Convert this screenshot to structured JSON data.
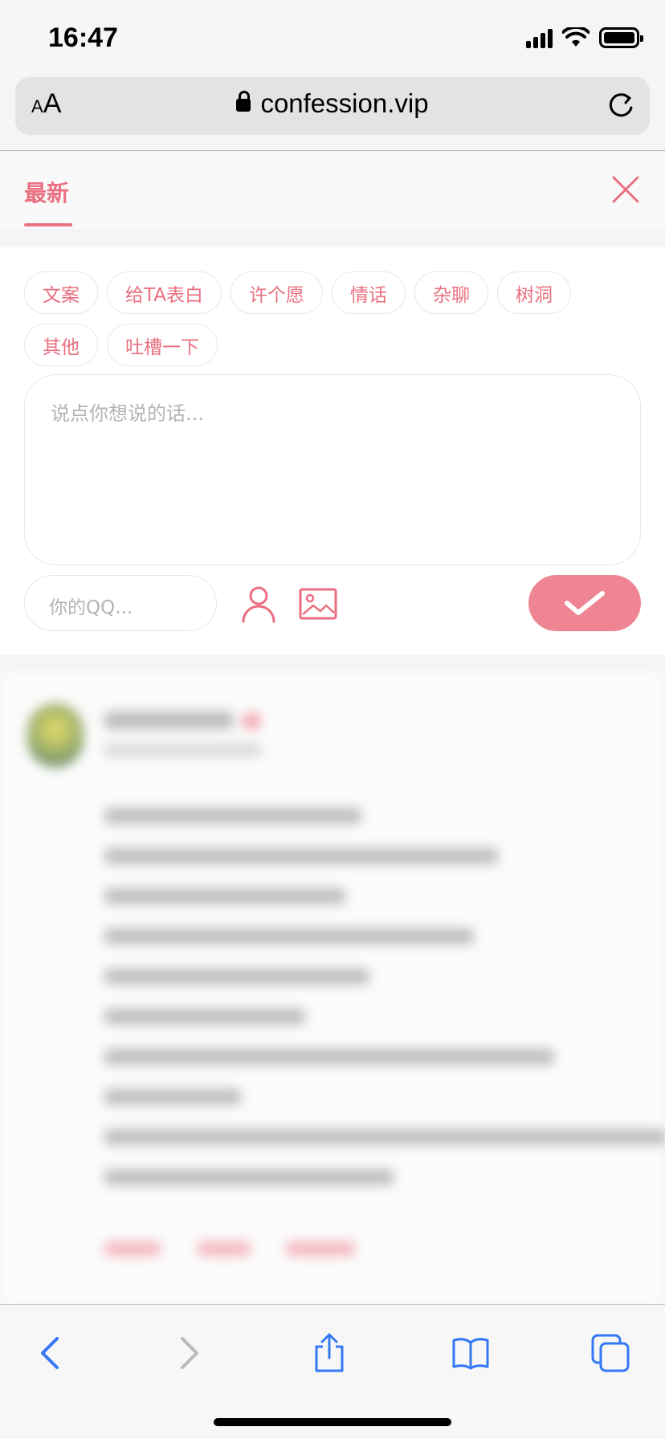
{
  "status_bar": {
    "time": "16:47"
  },
  "browser": {
    "text_size_small": "A",
    "text_size_big": "A",
    "url": "confession.vip"
  },
  "page": {
    "tab_latest": "最新",
    "tags": [
      "文案",
      "给TA表白",
      "许个愿",
      "情话",
      "杂聊",
      "树洞",
      "其他",
      "吐槽一下"
    ],
    "message_placeholder": "说点你想说的话...",
    "qq_placeholder": "你的QQ..."
  },
  "colors": {
    "accent": "#ea6f80",
    "submit_bg": "#ef8593",
    "ios_blue": "#3478f6"
  },
  "icons": [
    "close-icon",
    "user-icon",
    "image-icon",
    "check-icon",
    "back-icon",
    "forward-icon",
    "share-icon",
    "bookmarks-icon",
    "tabs-icon",
    "lock-icon",
    "reload-icon"
  ]
}
